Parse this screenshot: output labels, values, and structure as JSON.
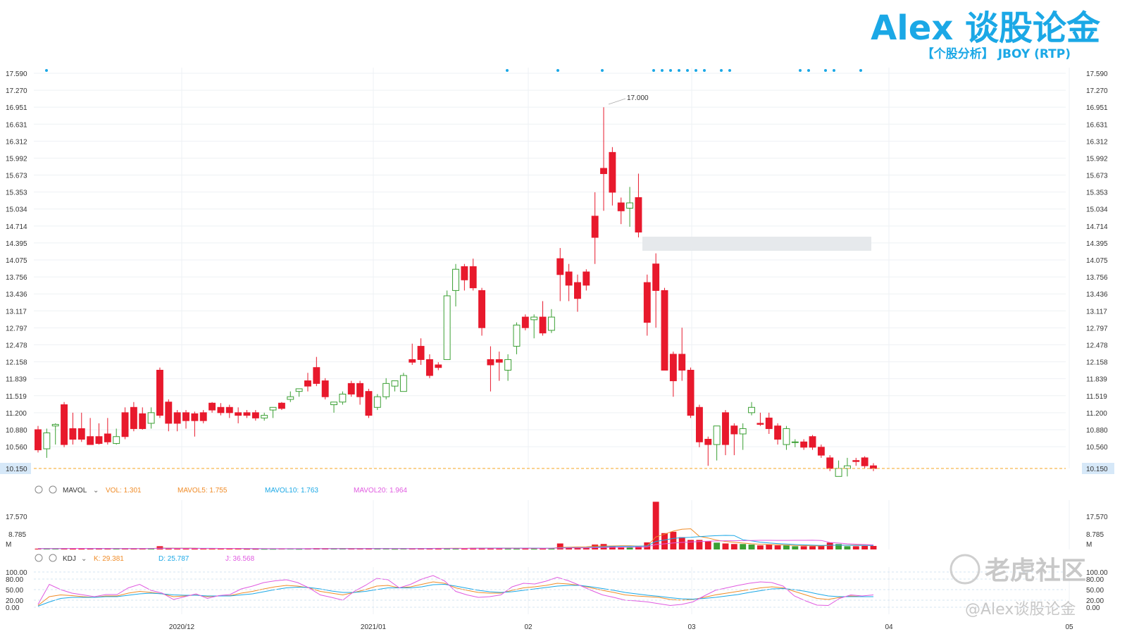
{
  "header": {
    "brand": "Alex 谈股论金",
    "subtitle": "【个股分析】  JBOY (RTP)"
  },
  "watermark": {
    "logo_text": "老虎社区",
    "handle": "@Alex谈股论金"
  },
  "colors": {
    "up": "#e8192c",
    "down": "#3ba034",
    "grid": "#eef1f4",
    "price_line": "#f5a623",
    "highlight": "#e6e9ec",
    "k": "#f08c28",
    "d": "#1ba8e6",
    "j": "#e05ae0",
    "mavol5": "#f08c28",
    "mavol10": "#1ba8e6",
    "mavol20": "#e05ae0"
  },
  "price_axis": {
    "ticks": [
      "17.590",
      "17.270",
      "16.951",
      "16.631",
      "16.312",
      "15.992",
      "15.673",
      "15.353",
      "15.034",
      "14.714",
      "14.395",
      "14.075",
      "13.756",
      "13.436",
      "13.117",
      "12.797",
      "12.478",
      "12.158",
      "11.839",
      "11.519",
      "11.200",
      "10.880",
      "10.560"
    ],
    "current_price": "10.150",
    "max_label": "17.000"
  },
  "volume_axis": {
    "ticks": [
      "17.570",
      "8.785"
    ],
    "unit": "M"
  },
  "kdj_axis": {
    "ticks": [
      "100.00",
      "80.00",
      "50.00",
      "20.00",
      "0.00"
    ]
  },
  "time_axis": [
    "2020/12",
    "2021/01",
    "02",
    "03",
    "04",
    "05"
  ],
  "mavol_legend": {
    "name": "MAVOL",
    "vol": "VOL: 1.301",
    "mavol5": "MAVOL5: 1.755",
    "mavol10": "MAVOL10: 1.763",
    "mavol20": "MAVOL20: 1.964"
  },
  "kdj_legend": {
    "name": "KDJ",
    "k": "K: 29.381",
    "d": "D: 25.787",
    "j": "J: 36.568"
  },
  "chart_data": {
    "type": "candlestick",
    "ylim": [
      10.15,
      17.59
    ],
    "candles": [
      {
        "o": 10.88,
        "h": 10.95,
        "l": 10.45,
        "c": 10.5,
        "v": 0.3
      },
      {
        "o": 10.52,
        "h": 10.9,
        "l": 10.35,
        "c": 10.82,
        "v": 0.3
      },
      {
        "o": 10.95,
        "h": 11.0,
        "l": 10.6,
        "c": 10.98,
        "v": 0.3
      },
      {
        "o": 11.35,
        "h": 11.4,
        "l": 10.55,
        "c": 10.6,
        "v": 0.5
      },
      {
        "o": 10.9,
        "h": 11.2,
        "l": 10.6,
        "c": 10.7,
        "v": 0.5
      },
      {
        "o": 10.9,
        "h": 11.2,
        "l": 10.65,
        "c": 10.7,
        "v": 0.4
      },
      {
        "o": 10.75,
        "h": 11.1,
        "l": 10.6,
        "c": 10.6,
        "v": 0.3
      },
      {
        "o": 10.75,
        "h": 11.0,
        "l": 10.6,
        "c": 10.62,
        "v": 0.3
      },
      {
        "o": 10.8,
        "h": 11.1,
        "l": 10.6,
        "c": 10.65,
        "v": 0.3
      },
      {
        "o": 10.62,
        "h": 10.9,
        "l": 10.6,
        "c": 10.75,
        "v": 0.3
      },
      {
        "o": 11.2,
        "h": 11.3,
        "l": 10.7,
        "c": 10.75,
        "v": 0.4
      },
      {
        "o": 11.3,
        "h": 11.4,
        "l": 10.85,
        "c": 10.9,
        "v": 0.4
      },
      {
        "o": 11.18,
        "h": 11.3,
        "l": 10.88,
        "c": 10.9,
        "v": 0.3
      },
      {
        "o": 11.0,
        "h": 11.3,
        "l": 10.9,
        "c": 11.2,
        "v": 0.3
      },
      {
        "o": 12.0,
        "h": 12.05,
        "l": 11.1,
        "c": 11.15,
        "v": 1.2
      },
      {
        "o": 11.4,
        "h": 11.45,
        "l": 10.85,
        "c": 11.0,
        "v": 0.4
      },
      {
        "o": 11.2,
        "h": 11.25,
        "l": 10.85,
        "c": 11.0,
        "v": 0.3
      },
      {
        "o": 11.2,
        "h": 11.25,
        "l": 10.9,
        "c": 11.05,
        "v": 0.3
      },
      {
        "o": 11.18,
        "h": 11.22,
        "l": 10.75,
        "c": 11.05,
        "v": 0.3
      },
      {
        "o": 11.2,
        "h": 11.25,
        "l": 11.0,
        "c": 11.05,
        "v": 0.3
      },
      {
        "o": 11.38,
        "h": 11.4,
        "l": 11.2,
        "c": 11.25,
        "v": 0.3
      },
      {
        "o": 11.3,
        "h": 11.38,
        "l": 11.15,
        "c": 11.2,
        "v": 0.3
      },
      {
        "o": 11.3,
        "h": 11.35,
        "l": 11.1,
        "c": 11.2,
        "v": 0.3
      },
      {
        "o": 11.2,
        "h": 11.3,
        "l": 11.0,
        "c": 11.15,
        "v": 0.3
      },
      {
        "o": 11.2,
        "h": 11.25,
        "l": 11.1,
        "c": 11.15,
        "v": 0.2
      },
      {
        "o": 11.2,
        "h": 11.25,
        "l": 11.05,
        "c": 11.1,
        "v": 0.2
      },
      {
        "o": 11.1,
        "h": 11.2,
        "l": 11.05,
        "c": 11.15,
        "v": 0.2
      },
      {
        "o": 11.25,
        "h": 11.3,
        "l": 11.1,
        "c": 11.3,
        "v": 0.2
      },
      {
        "o": 11.38,
        "h": 11.4,
        "l": 11.25,
        "c": 11.28,
        "v": 0.3
      },
      {
        "o": 11.45,
        "h": 11.6,
        "l": 11.4,
        "c": 11.5,
        "v": 0.3
      },
      {
        "o": 11.6,
        "h": 11.65,
        "l": 11.5,
        "c": 11.65,
        "v": 0.2
      },
      {
        "o": 11.8,
        "h": 11.95,
        "l": 11.6,
        "c": 11.7,
        "v": 0.3
      },
      {
        "o": 12.05,
        "h": 12.25,
        "l": 11.7,
        "c": 11.75,
        "v": 0.5
      },
      {
        "o": 11.8,
        "h": 11.85,
        "l": 11.45,
        "c": 11.5,
        "v": 0.5
      },
      {
        "o": 11.35,
        "h": 11.4,
        "l": 11.2,
        "c": 11.4,
        "v": 0.3
      },
      {
        "o": 11.4,
        "h": 11.6,
        "l": 11.35,
        "c": 11.55,
        "v": 0.3
      },
      {
        "o": 11.75,
        "h": 11.8,
        "l": 11.5,
        "c": 11.55,
        "v": 0.3
      },
      {
        "o": 11.75,
        "h": 11.8,
        "l": 11.35,
        "c": 11.5,
        "v": 0.4
      },
      {
        "o": 11.6,
        "h": 11.65,
        "l": 11.1,
        "c": 11.15,
        "v": 0.5
      },
      {
        "o": 11.3,
        "h": 11.55,
        "l": 11.25,
        "c": 11.5,
        "v": 0.3
      },
      {
        "o": 11.5,
        "h": 11.85,
        "l": 11.45,
        "c": 11.75,
        "v": 0.3
      },
      {
        "o": 11.7,
        "h": 11.8,
        "l": 11.6,
        "c": 11.8,
        "v": 0.2
      },
      {
        "o": 11.6,
        "h": 11.95,
        "l": 11.6,
        "c": 11.9,
        "v": 0.4
      },
      {
        "o": 12.2,
        "h": 12.5,
        "l": 12.1,
        "c": 12.15,
        "v": 0.4
      },
      {
        "o": 12.45,
        "h": 12.6,
        "l": 12.1,
        "c": 12.2,
        "v": 0.5
      },
      {
        "o": 12.2,
        "h": 12.3,
        "l": 11.85,
        "c": 11.9,
        "v": 0.5
      },
      {
        "o": 12.1,
        "h": 12.15,
        "l": 12.0,
        "c": 12.05,
        "v": 0.3
      },
      {
        "o": 12.2,
        "h": 13.5,
        "l": 12.2,
        "c": 13.4,
        "v": 0.4
      },
      {
        "o": 13.5,
        "h": 14.0,
        "l": 13.2,
        "c": 13.9,
        "v": 0.5
      },
      {
        "o": 13.95,
        "h": 14.0,
        "l": 13.5,
        "c": 13.7,
        "v": 0.4
      },
      {
        "o": 13.95,
        "h": 14.1,
        "l": 13.5,
        "c": 13.55,
        "v": 0.6
      },
      {
        "o": 13.5,
        "h": 13.55,
        "l": 12.65,
        "c": 12.8,
        "v": 0.6
      },
      {
        "o": 12.2,
        "h": 12.45,
        "l": 11.6,
        "c": 12.1,
        "v": 0.5
      },
      {
        "o": 12.2,
        "h": 12.35,
        "l": 11.8,
        "c": 12.15,
        "v": 0.5
      },
      {
        "o": 12.0,
        "h": 12.3,
        "l": 11.8,
        "c": 12.2,
        "v": 0.4
      },
      {
        "o": 12.45,
        "h": 12.9,
        "l": 12.3,
        "c": 12.85,
        "v": 0.4
      },
      {
        "o": 13.0,
        "h": 13.05,
        "l": 12.75,
        "c": 12.8,
        "v": 0.5
      },
      {
        "o": 12.95,
        "h": 13.05,
        "l": 12.6,
        "c": 13.0,
        "v": 0.4
      },
      {
        "o": 13.0,
        "h": 13.3,
        "l": 12.65,
        "c": 12.7,
        "v": 0.4
      },
      {
        "o": 12.75,
        "h": 13.15,
        "l": 12.7,
        "c": 13.0,
        "v": 0.4
      },
      {
        "o": 14.1,
        "h": 14.3,
        "l": 13.3,
        "c": 13.8,
        "v": 2.2
      },
      {
        "o": 13.85,
        "h": 14.0,
        "l": 13.3,
        "c": 13.6,
        "v": 0.9
      },
      {
        "o": 13.65,
        "h": 13.8,
        "l": 13.1,
        "c": 13.35,
        "v": 0.7
      },
      {
        "o": 13.85,
        "h": 13.9,
        "l": 13.5,
        "c": 13.6,
        "v": 0.7
      },
      {
        "o": 14.9,
        "h": 15.35,
        "l": 14.0,
        "c": 14.5,
        "v": 1.8
      },
      {
        "o": 15.8,
        "h": 16.95,
        "l": 15.0,
        "c": 15.7,
        "v": 2.0
      },
      {
        "o": 16.1,
        "h": 16.2,
        "l": 15.1,
        "c": 15.35,
        "v": 1.3
      },
      {
        "o": 15.15,
        "h": 15.25,
        "l": 14.75,
        "c": 15.0,
        "v": 0.9
      },
      {
        "o": 15.05,
        "h": 15.45,
        "l": 14.7,
        "c": 15.15,
        "v": 0.8
      },
      {
        "o": 15.25,
        "h": 15.7,
        "l": 14.5,
        "c": 14.6,
        "v": 1.1
      },
      {
        "o": 13.65,
        "h": 13.8,
        "l": 12.65,
        "c": 12.9,
        "v": 2.6
      },
      {
        "o": 14.0,
        "h": 14.2,
        "l": 12.8,
        "c": 13.5,
        "v": 17.5
      },
      {
        "o": 13.5,
        "h": 13.55,
        "l": 12.0,
        "c": 12.0,
        "v": 6.0
      },
      {
        "o": 12.3,
        "h": 12.35,
        "l": 11.5,
        "c": 11.8,
        "v": 6.5
      },
      {
        "o": 12.3,
        "h": 12.8,
        "l": 11.8,
        "c": 12.0,
        "v": 4.5
      },
      {
        "o": 12.0,
        "h": 12.05,
        "l": 11.1,
        "c": 11.15,
        "v": 3.5
      },
      {
        "o": 11.3,
        "h": 11.35,
        "l": 10.55,
        "c": 10.65,
        "v": 3.5
      },
      {
        "o": 10.7,
        "h": 10.75,
        "l": 10.2,
        "c": 10.6,
        "v": 3.0
      },
      {
        "o": 10.6,
        "h": 10.95,
        "l": 10.3,
        "c": 10.95,
        "v": 2.5
      },
      {
        "o": 11.2,
        "h": 11.25,
        "l": 10.4,
        "c": 10.6,
        "v": 2.2
      },
      {
        "o": 10.95,
        "h": 11.0,
        "l": 10.4,
        "c": 10.8,
        "v": 2.0
      },
      {
        "o": 10.8,
        "h": 11.0,
        "l": 10.5,
        "c": 10.9,
        "v": 2.0
      },
      {
        "o": 11.2,
        "h": 11.4,
        "l": 11.15,
        "c": 11.3,
        "v": 1.8
      },
      {
        "o": 11.0,
        "h": 11.2,
        "l": 10.95,
        "c": 10.98,
        "v": 1.5
      },
      {
        "o": 11.1,
        "h": 11.2,
        "l": 10.8,
        "c": 10.9,
        "v": 1.8
      },
      {
        "o": 10.95,
        "h": 11.0,
        "l": 10.6,
        "c": 10.7,
        "v": 1.5
      },
      {
        "o": 10.6,
        "h": 10.95,
        "l": 10.5,
        "c": 10.9,
        "v": 1.5
      },
      {
        "o": 10.65,
        "h": 10.7,
        "l": 10.55,
        "c": 10.65,
        "v": 1.2
      },
      {
        "o": 10.65,
        "h": 10.7,
        "l": 10.5,
        "c": 10.55,
        "v": 1.2
      },
      {
        "o": 10.75,
        "h": 10.78,
        "l": 10.5,
        "c": 10.55,
        "v": 1.2
      },
      {
        "o": 10.55,
        "h": 10.6,
        "l": 10.35,
        "c": 10.4,
        "v": 1.3
      },
      {
        "o": 10.35,
        "h": 10.4,
        "l": 10.1,
        "c": 10.15,
        "v": 2.5
      },
      {
        "o": 10.0,
        "h": 10.3,
        "l": 10.0,
        "c": 10.15,
        "v": 2.0
      },
      {
        "o": 10.15,
        "h": 10.35,
        "l": 10.0,
        "c": 10.2,
        "v": 1.2
      },
      {
        "o": 10.3,
        "h": 10.35,
        "l": 10.2,
        "c": 10.28,
        "v": 1.2
      },
      {
        "o": 10.35,
        "h": 10.38,
        "l": 10.15,
        "c": 10.2,
        "v": 1.3
      },
      {
        "o": 10.2,
        "h": 10.25,
        "l": 10.1,
        "c": 10.15,
        "v": 1.3
      }
    ],
    "kdj": {
      "k": [
        5,
        30,
        35,
        33,
        30,
        28,
        32,
        32,
        40,
        45,
        42,
        38,
        30,
        32,
        35,
        30,
        32,
        33,
        40,
        45,
        52,
        58,
        62,
        60,
        55,
        45,
        40,
        35,
        42,
        50,
        60,
        62,
        55,
        58,
        65,
        72,
        68,
        55,
        48,
        42,
        40,
        40,
        48,
        55,
        58,
        62,
        68,
        66,
        62,
        55,
        48,
        42,
        35,
        32,
        30,
        28,
        22,
        20,
        22,
        28,
        35,
        40,
        45,
        50,
        55,
        58,
        55,
        45,
        35,
        25,
        22,
        28,
        32,
        30,
        30
      ],
      "d": [
        3,
        15,
        25,
        28,
        28,
        28,
        30,
        30,
        34,
        38,
        40,
        38,
        35,
        34,
        34,
        32,
        32,
        32,
        35,
        38,
        44,
        50,
        55,
        57,
        56,
        52,
        46,
        42,
        42,
        45,
        50,
        55,
        55,
        55,
        58,
        64,
        65,
        60,
        54,
        48,
        44,
        42,
        44,
        48,
        52,
        56,
        60,
        62,
        62,
        58,
        53,
        48,
        42,
        38,
        34,
        31,
        27,
        24,
        23,
        25,
        28,
        32,
        36,
        42,
        47,
        52,
        53,
        50,
        45,
        38,
        32,
        30,
        30,
        30,
        30
      ],
      "j": [
        8,
        65,
        50,
        40,
        35,
        30,
        36,
        36,
        55,
        65,
        48,
        40,
        22,
        30,
        38,
        25,
        33,
        36,
        52,
        60,
        70,
        75,
        78,
        70,
        55,
        35,
        28,
        20,
        45,
        62,
        82,
        78,
        55,
        65,
        80,
        90,
        75,
        45,
        35,
        28,
        30,
        35,
        58,
        68,
        66,
        74,
        85,
        75,
        62,
        48,
        35,
        28,
        20,
        18,
        15,
        10,
        5,
        8,
        15,
        32,
        48,
        55,
        62,
        68,
        72,
        70,
        60,
        32,
        18,
        6,
        5,
        25,
        35,
        32,
        35
      ]
    }
  }
}
